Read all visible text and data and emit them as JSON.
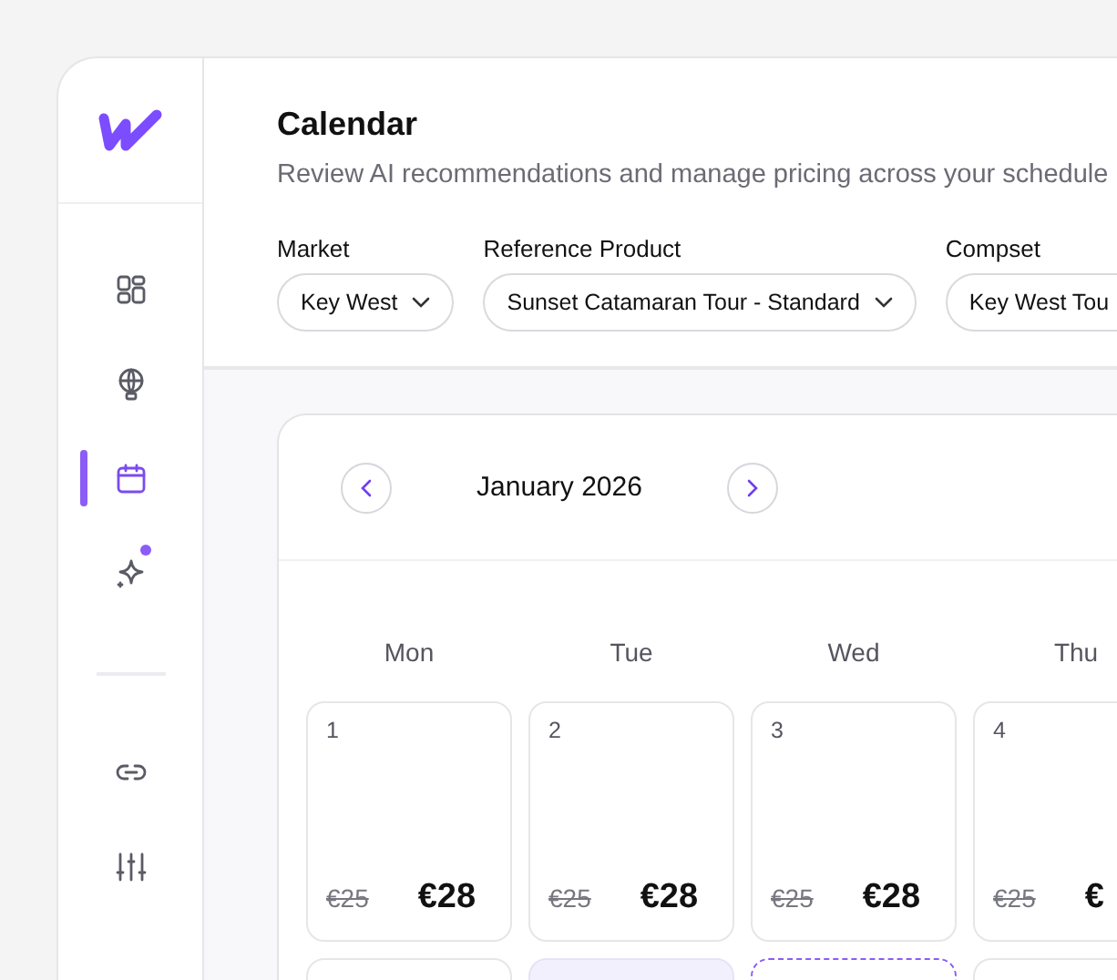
{
  "sidebar": {
    "nav_items": [
      {
        "kind": "grid",
        "selected": false,
        "badge": false
      },
      {
        "kind": "balloon",
        "selected": false,
        "badge": false
      },
      {
        "kind": "calendar",
        "selected": true,
        "badge": false
      },
      {
        "kind": "sparkle",
        "selected": false,
        "badge": true
      }
    ],
    "bottom_items": [
      {
        "kind": "link",
        "selected": false,
        "badge": false
      },
      {
        "kind": "sliders",
        "selected": false,
        "badge": false
      }
    ]
  },
  "header": {
    "title": "Calendar",
    "subtitle": "Review AI recommendations and manage pricing across your schedule",
    "filters": [
      {
        "label": "Market",
        "value": "Key West"
      },
      {
        "label": "Reference Product",
        "value": "Sunset Catamaran Tour - Standard"
      },
      {
        "label": "Compset",
        "value": "Key West Tou"
      }
    ]
  },
  "calendar": {
    "month": "January 2026",
    "weekdays": [
      "Mon",
      "Tue",
      "Wed",
      "Thu"
    ],
    "weeks": [
      [
        {
          "kind": "price",
          "day": "1",
          "old_price": "€25",
          "new_price": "€28"
        },
        {
          "kind": "price",
          "day": "2",
          "old_price": "€25",
          "new_price": "€28"
        },
        {
          "kind": "price",
          "day": "3",
          "old_price": "€25",
          "new_price": "€28"
        },
        {
          "kind": "price",
          "day": "4",
          "old_price": "€25",
          "new_price": "€"
        }
      ],
      [
        {
          "kind": "plain"
        },
        {
          "kind": "highlighted"
        },
        {
          "kind": "dashed"
        },
        {
          "kind": "plain"
        }
      ]
    ]
  }
}
